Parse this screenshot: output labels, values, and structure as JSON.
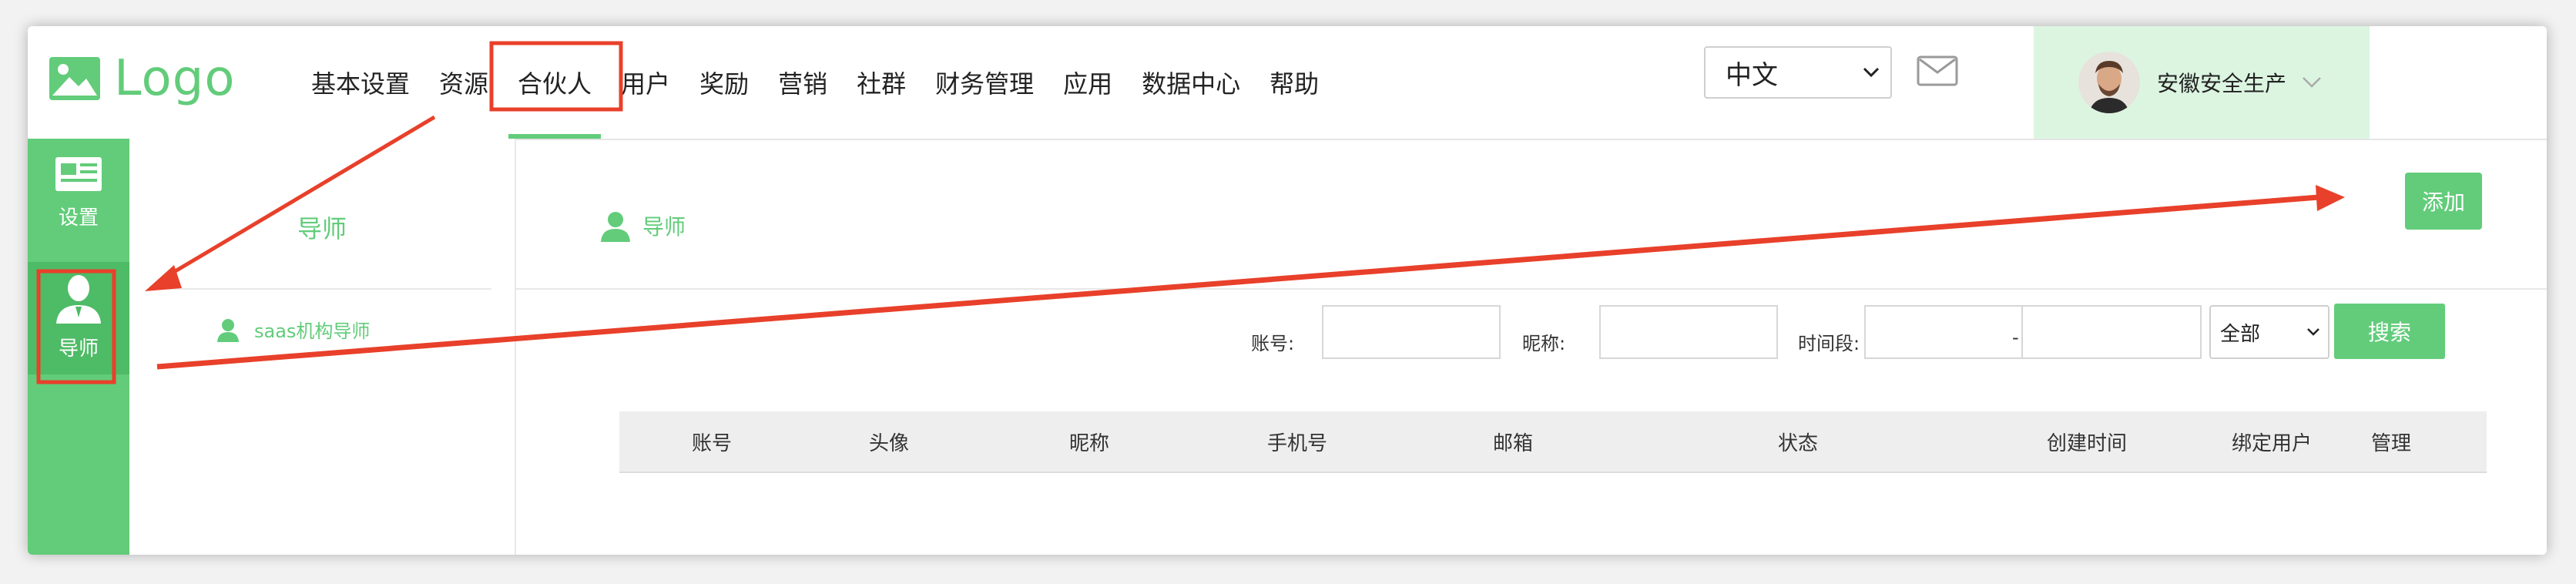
{
  "header": {
    "logo_text": "Logo",
    "nav": [
      "基本设置",
      "资源",
      "合伙人",
      "用户",
      "奖励",
      "营销",
      "社群",
      "财务管理",
      "应用",
      "数据中心",
      "帮助"
    ],
    "nav_active_index": 2,
    "language": "中文",
    "user_name": "安徽安全生产"
  },
  "sidebar": {
    "items": [
      {
        "label": "设置",
        "icon": "id-card-icon"
      },
      {
        "label": "导师",
        "icon": "user-icon",
        "active": true
      }
    ]
  },
  "submenu": {
    "title": "导师",
    "items": [
      {
        "label": "saas机构导师",
        "icon": "user-icon"
      }
    ]
  },
  "main": {
    "breadcrumb": "导师",
    "add_label": "添加",
    "filters": {
      "account_label": "账号:",
      "nickname_label": "昵称:",
      "time_label": "时间段:",
      "range_sep": "-",
      "status_select": "全部",
      "search_label": "搜索"
    },
    "table": {
      "columns": [
        "账号",
        "头像",
        "昵称",
        "手机号",
        "邮箱",
        "状态",
        "创建时间",
        "绑定用户",
        "管理"
      ]
    }
  },
  "colors": {
    "accent": "#62cc7a",
    "sidebar_active": "#4ebb66",
    "user_panel_bg": "#dcf5e1",
    "annotation_red": "#e8402a"
  }
}
